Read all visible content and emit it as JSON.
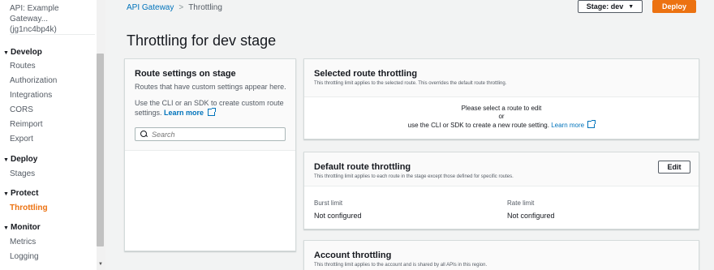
{
  "sidebar": {
    "api_name": "API: Example Gateway...",
    "api_id": "(jg1nc4bp4k)",
    "sections": [
      {
        "label": "Develop",
        "items": [
          "Routes",
          "Authorization",
          "Integrations",
          "CORS",
          "Reimport",
          "Export"
        ]
      },
      {
        "label": "Deploy",
        "items": [
          "Stages"
        ]
      },
      {
        "label": "Protect",
        "items": [
          "Throttling"
        ]
      },
      {
        "label": "Monitor",
        "items": [
          "Metrics",
          "Logging"
        ]
      }
    ],
    "active_item": "Throttling"
  },
  "breadcrumb": {
    "root": "API Gateway",
    "current": "Throttling"
  },
  "header": {
    "stage_label": "Stage: dev",
    "deploy_label": "Deploy"
  },
  "page_title": "Throttling for dev stage",
  "route_settings": {
    "title": "Route settings on stage",
    "description": "Routes that have custom settings appear here.",
    "cli_text": "Use the CLI or an SDK to create custom route settings.",
    "learn_more": "Learn more",
    "search_placeholder": "Search"
  },
  "selected_route": {
    "title": "Selected route throttling",
    "subtitle": "This throttling limit applies to the selected route. This overrides the default route throttling.",
    "line1": "Please select a route to edit",
    "line2": "or",
    "line3": "use the CLI or SDK to create a new route setting.",
    "learn_more": "Learn more"
  },
  "default_route": {
    "title": "Default route throttling",
    "subtitle": "This throttling limit applies to each route in the stage except those defined for specific routes.",
    "edit_label": "Edit",
    "burst_label": "Burst limit",
    "burst_value": "Not configured",
    "rate_label": "Rate limit",
    "rate_value": "Not configured"
  },
  "account": {
    "title": "Account throttling",
    "subtitle": "This throttling limit applies to the account and is shared by all APIs in this region."
  },
  "colors": {
    "accent": "#ec7211",
    "link": "#0073bb"
  }
}
